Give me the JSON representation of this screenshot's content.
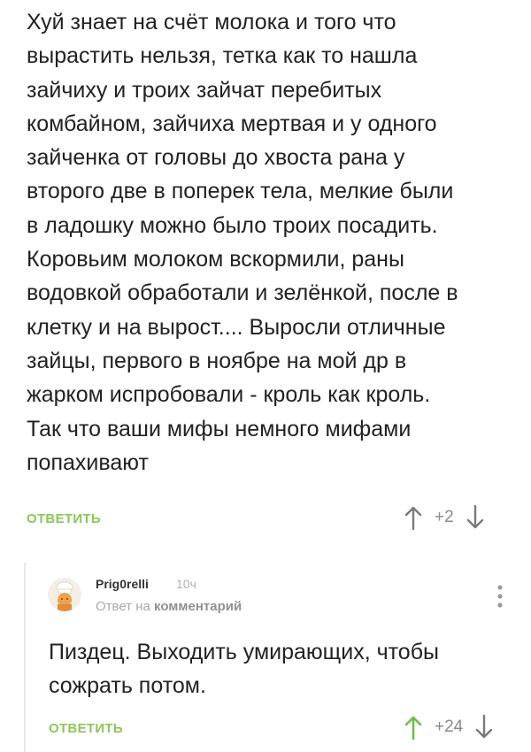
{
  "comment": {
    "text": "Хуй знает на счёт молока и того что\nвырастить нельзя, тетка как то нашла\nзайчиху и троих зайчат перебитых\nкомбайном, зайчиха мертвая и у одного\nзайченка от головы до хвоста рана у\nвторого две в поперек тела, мелкие были\nв ладошку можно было троих посадить.\nКоровьим молоком вскормили, раны\nводовкой обработали и зелёнкой, после в\nклетку и на вырост.... Выросли отличные\nзайцы, первого в ноябре на мой др в\nжарком испробовали - кроль как кроль.\nТак что ваши мифы немного мифами\nпопахивают",
    "reply_label": "ОТВЕТИТЬ",
    "score": "+2"
  },
  "reply": {
    "username": "Prig0relli",
    "time": "10ч",
    "meta_prefix": "Ответ на",
    "meta_link": "комментарий",
    "text": "Пиздец. Выходить умирающих, чтобы\nсожрать потом.",
    "reply_label": "ОТВЕТИТЬ",
    "score": "+24"
  },
  "colors": {
    "accent": "#8ac858",
    "muted": "#8b8b8b",
    "text": "#222222"
  },
  "icons": {
    "upvote": "arrow-up-icon",
    "downvote": "arrow-down-icon",
    "more": "kebab-menu-icon",
    "avatar": "cook-avatar"
  }
}
